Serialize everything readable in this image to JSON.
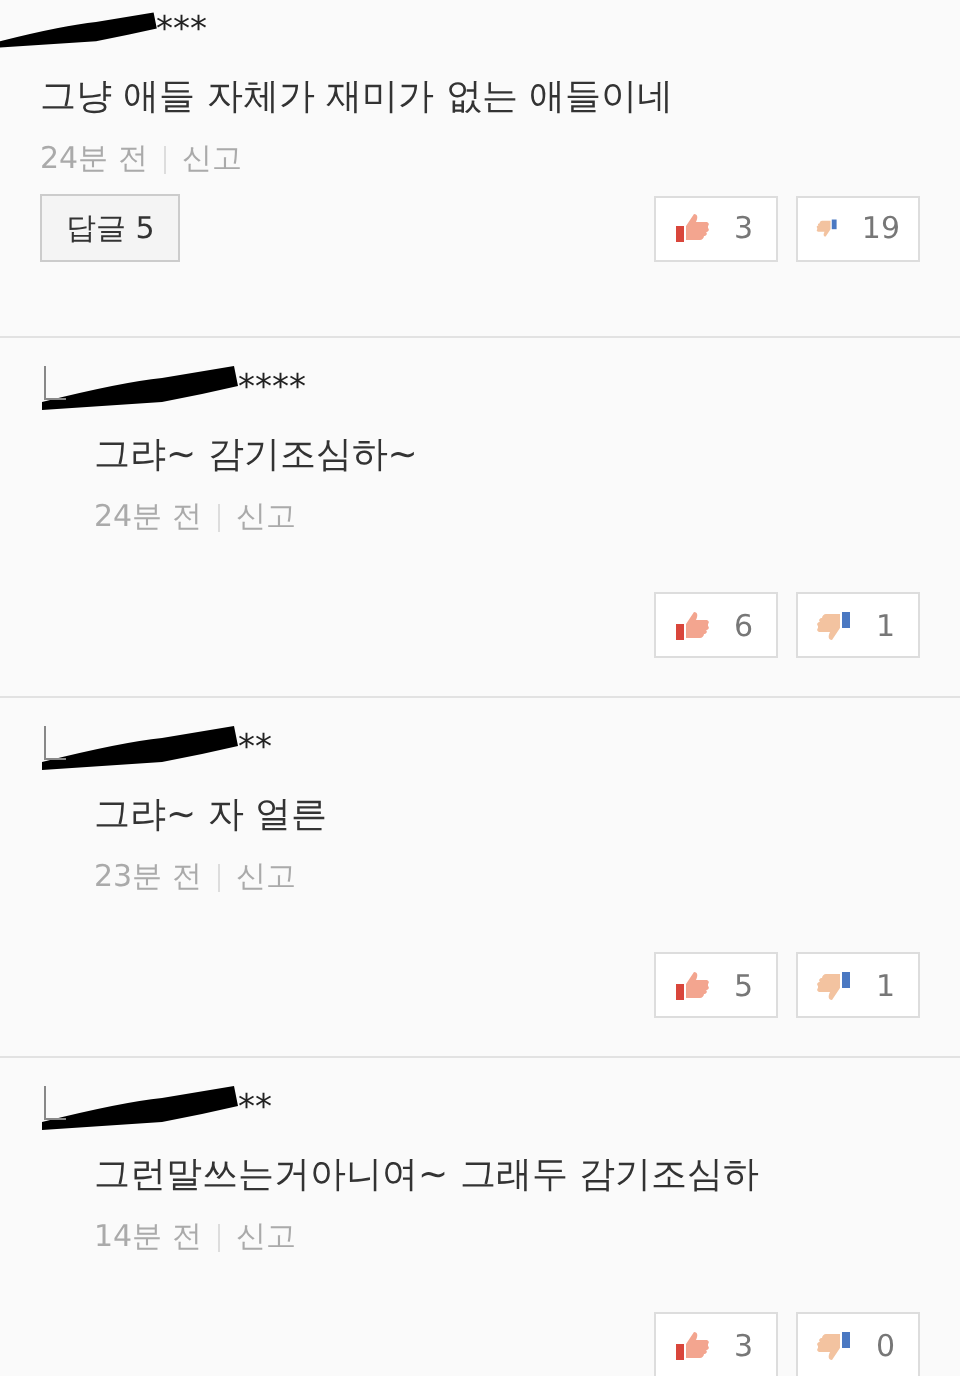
{
  "comments": [
    {
      "kind": "comment",
      "author": "***",
      "text": "그냥 애들 자체가 재미가 없는 애들이네",
      "time": "24분 전",
      "report": "신고",
      "reply_button": "답글 5",
      "likes": "3",
      "dislikes": "19"
    },
    {
      "kind": "reply",
      "author": "****",
      "text": "그랴~ 감기조심하~",
      "time": "24분 전",
      "report": "신고",
      "likes": "6",
      "dislikes": "1"
    },
    {
      "kind": "reply",
      "author": "**",
      "text": "그랴~ 자 얼른",
      "time": "23분 전",
      "report": "신고",
      "likes": "5",
      "dislikes": "1"
    },
    {
      "kind": "reply",
      "author": "**",
      "text": "그런말쓰는거아니여~ 그래두 감기조심하",
      "time": "14분 전",
      "report": "신고",
      "likes": "3",
      "dislikes": "0"
    }
  ]
}
